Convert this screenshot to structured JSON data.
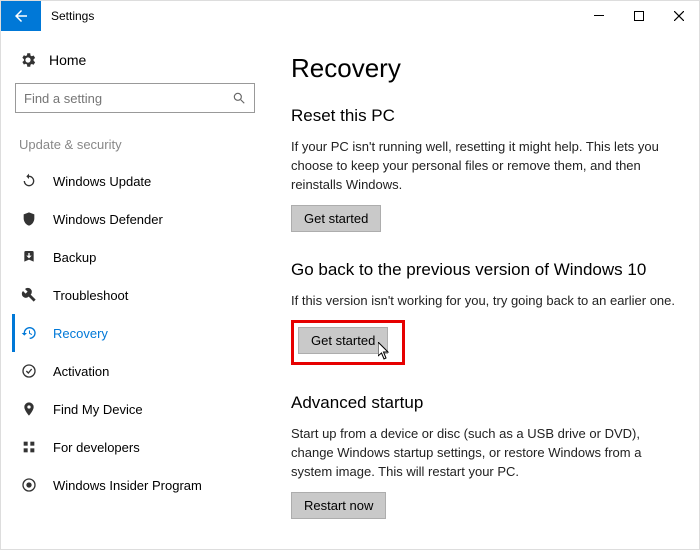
{
  "window": {
    "title": "Settings"
  },
  "sidebar": {
    "home_label": "Home",
    "search_placeholder": "Find a setting",
    "category_label": "Update & security",
    "items": [
      {
        "label": "Windows Update"
      },
      {
        "label": "Windows Defender"
      },
      {
        "label": "Backup"
      },
      {
        "label": "Troubleshoot"
      },
      {
        "label": "Recovery"
      },
      {
        "label": "Activation"
      },
      {
        "label": "Find My Device"
      },
      {
        "label": "For developers"
      },
      {
        "label": "Windows Insider Program"
      }
    ]
  },
  "main": {
    "page_title": "Recovery",
    "reset": {
      "heading": "Reset this PC",
      "body": "If your PC isn't running well, resetting it might help. This lets you choose to keep your personal files or remove them, and then reinstalls Windows.",
      "button": "Get started"
    },
    "goback": {
      "heading": "Go back to the previous version of Windows 10",
      "body": "If this version isn't working for you, try going back to an earlier one.",
      "button": "Get started"
    },
    "advanced": {
      "heading": "Advanced startup",
      "body": "Start up from a device or disc (such as a USB drive or DVD), change Windows startup settings, or restore Windows from a system image. This will restart your PC.",
      "button": "Restart now"
    }
  }
}
